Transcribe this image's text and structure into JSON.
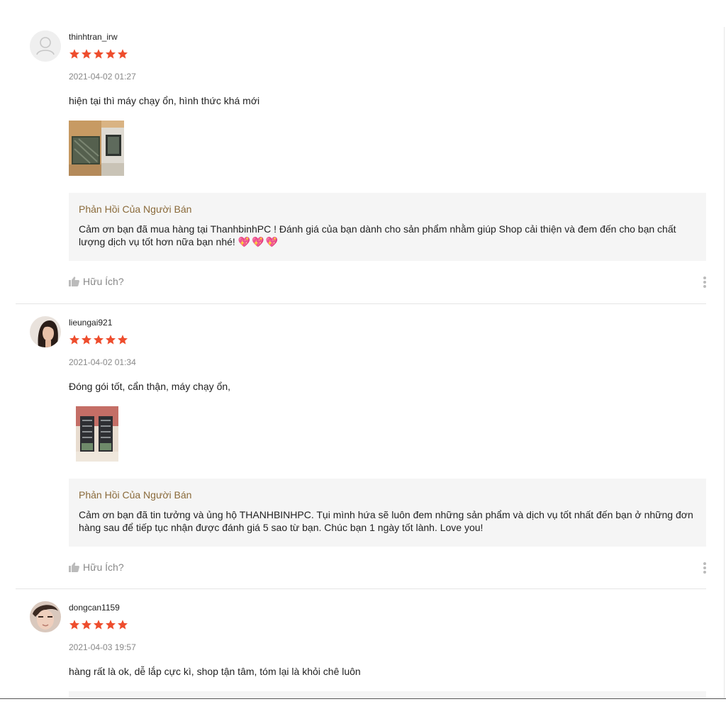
{
  "reviews": [
    {
      "author": "thinhtran_irw",
      "rating": 5,
      "time": "2021-04-02 01:27",
      "content": "hiện tại thì máy chạy ổn, hình thức khá mới",
      "avatar": "default-user-icon",
      "reply_title": "Phản Hồi Của Người Bán",
      "reply_text": "Cảm ơn bạn đã mua hàng tại ThanhbinhPC ! Đánh giá của bạn dành cho sản phẩm nhằm giúp Shop cải thiện và đem đến cho bạn chất lượng dịch vụ tốt hơn nữa bạn nhé!",
      "reply_hearts": "💖💖💖",
      "helpful_label": "Hữu Ích?"
    },
    {
      "author": "lieungai921",
      "rating": 5,
      "time": "2021-04-02 01:34",
      "content": "Đóng gói tốt, cẩn thận, máy chạy ổn,",
      "avatar": "user-photo",
      "reply_title": "Phản Hồi Của Người Bán",
      "reply_text": "Cảm ơn bạn đã tin tưởng và ủng hộ THANHBINHPC. Tụi mình hứa sẽ luôn đem những sản phẩm và dịch vụ tốt nhất đến bạn ở những đơn hàng sau để tiếp tục nhận được đánh giá 5 sao từ bạn. Chúc bạn 1 ngày tốt lành. Love you!",
      "helpful_label": "Hữu Ích?"
    },
    {
      "author": "dongcan1159",
      "rating": 5,
      "time": "2021-04-03 19:57",
      "content": "hàng rất là ok, dễ lắp cực kì, shop tận tâm, tóm lại là khỏi chê luôn",
      "avatar": "user-photo"
    }
  ],
  "colors": {
    "star": "#ee4d2d",
    "reply_title": "#8a6a3a",
    "reply_bg": "#f5f5f5",
    "muted": "#888888",
    "heart": "#e8306a"
  },
  "icons": [
    "star-icon",
    "thumbs-up-icon",
    "more-vertical-icon",
    "default-user-icon"
  ]
}
